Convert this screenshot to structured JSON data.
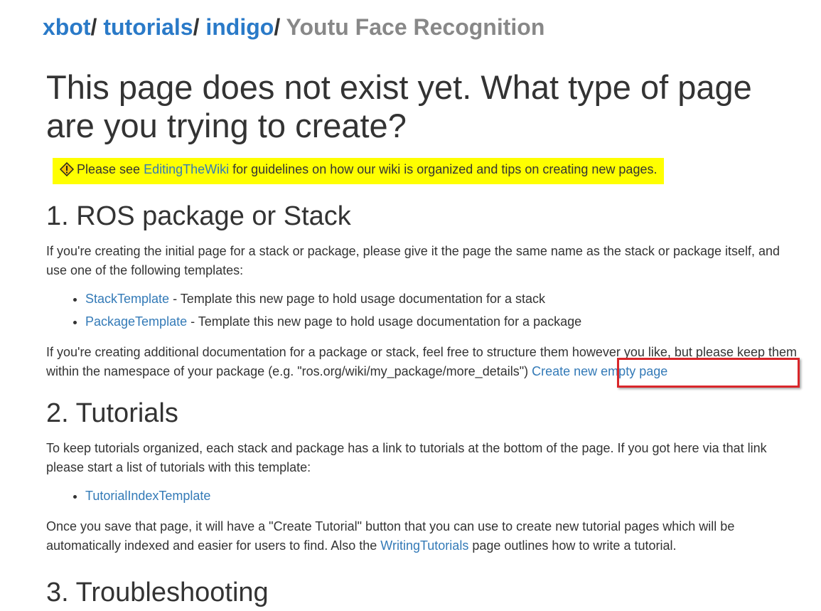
{
  "breadcrumb": {
    "items": [
      {
        "label": "xbot"
      },
      {
        "label": "tutorials"
      },
      {
        "label": "indigo"
      }
    ],
    "separator": "/",
    "current": "Youtu Face Recognition"
  },
  "page_title": "This page does not exist yet. What type of page are you trying to create?",
  "notice": {
    "icon": "warning-icon",
    "before": "Please see ",
    "link": "EditingTheWiki",
    "after": " for guidelines on how our wiki is organized and tips on creating new pages.",
    "background": "#ffff00"
  },
  "sections": {
    "ros": {
      "heading": "1. ROS package or Stack",
      "intro": "If you're creating the initial page for a stack or package, please give it the page the same name as the stack or package itself, and use one of the following templates:",
      "templates": [
        {
          "link": "StackTemplate",
          "desc": " - Template this new page to hold usage documentation for a stack"
        },
        {
          "link": "PackageTemplate",
          "desc": " - Template this new page to hold usage documentation for a package"
        }
      ],
      "additional_text": "If you're creating additional documentation for a package or stack, feel free to structure them however you like, but please keep them within the namespace of your package (e.g. \"ros.org/wiki/my_package/more_details\") ",
      "create_link": "Create new empty page"
    },
    "tutorials": {
      "heading": "2. Tutorials",
      "intro": "To keep tutorials organized, each stack and package has a link to tutorials at the bottom of the page. If you got here via that link please start a list of tutorials with this template:",
      "templates": [
        {
          "link": "TutorialIndexTemplate"
        }
      ],
      "outro_before": "Once you save that page, it will have a \"Create Tutorial\" button that you can use to create new tutorial pages which will be automatically indexed and easier for users to find. Also the ",
      "outro_link": "WritingTutorials",
      "outro_after": " page outlines how to write a tutorial."
    },
    "troubleshooting": {
      "heading": "3. Troubleshooting"
    }
  },
  "colors": {
    "link": "#337ab7",
    "highlight_border": "#d9262a"
  }
}
